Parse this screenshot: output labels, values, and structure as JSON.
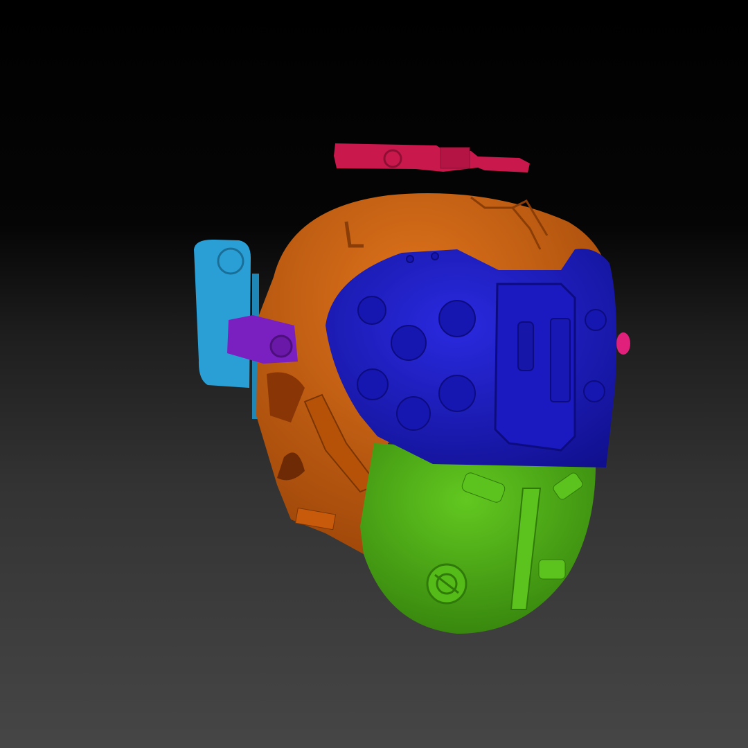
{
  "scene": {
    "subject": "helmet-model",
    "colors": {
      "background_top": "#000000",
      "background_bottom": "#464646",
      "top_antenna": "#c8184c",
      "dome": "#d2610f",
      "visor": "#1c1ccf",
      "jaw": "#52b816",
      "side_handle": "#2a9fd6",
      "side_block": "#7a20c0",
      "side_knob": "#e0207a"
    }
  }
}
